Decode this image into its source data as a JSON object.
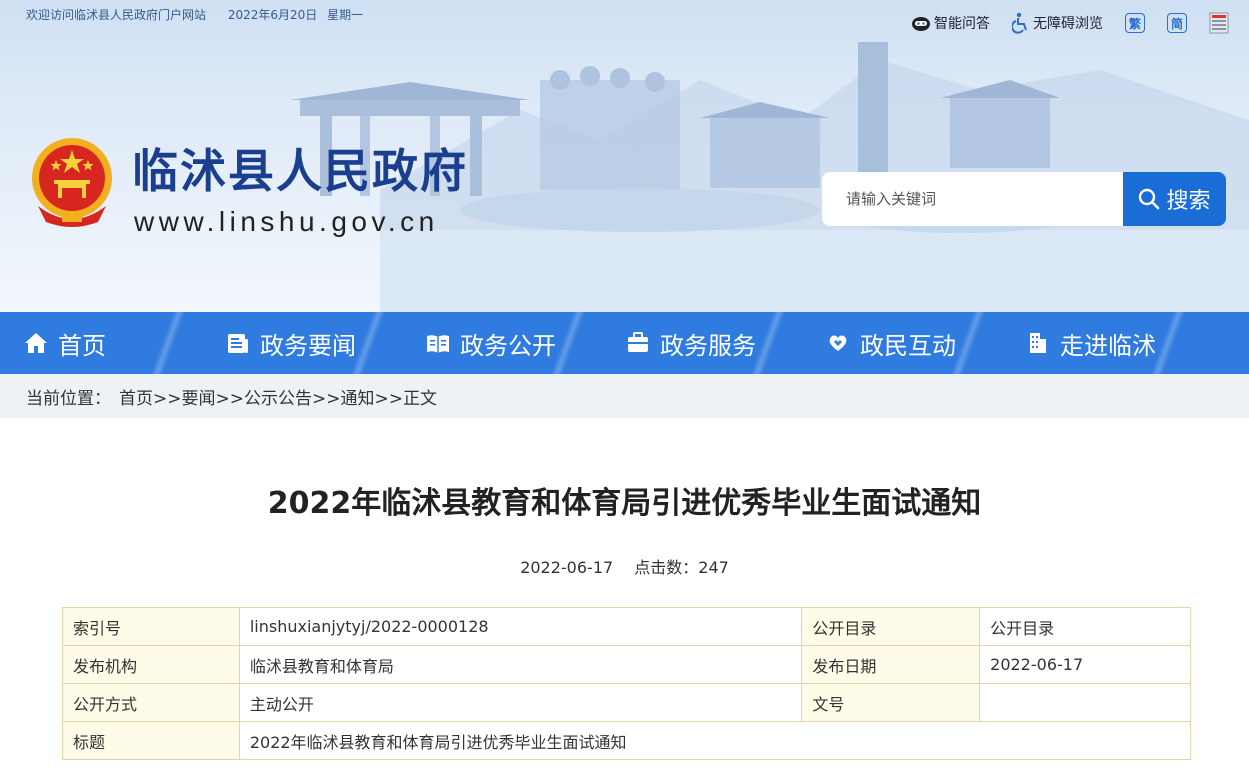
{
  "topbar": {
    "welcome": "欢迎访问临沭县人民政府门户网站",
    "date": "2022年6月20日",
    "weekday": "星期一",
    "tools": [
      {
        "label": "智能问答",
        "icon": "robot-icon"
      },
      {
        "label": "无障碍浏览",
        "icon": "accessibility-icon"
      }
    ],
    "traditional": "繁",
    "simplified": "简"
  },
  "header": {
    "site_name": "临沭县人民政府",
    "site_url": "www.linshu.gov.cn"
  },
  "search": {
    "placeholder": "请输入关键词",
    "button_label": "搜索"
  },
  "nav": {
    "items": [
      {
        "label": "首页",
        "icon": "home-icon"
      },
      {
        "label": "政务要闻",
        "icon": "news-icon"
      },
      {
        "label": "政务公开",
        "icon": "book-icon"
      },
      {
        "label": "政务服务",
        "icon": "service-icon"
      },
      {
        "label": "政民互动",
        "icon": "heart-hands-icon"
      },
      {
        "label": "走进临沭",
        "icon": "building-icon"
      }
    ]
  },
  "breadcrumb": {
    "label": "当前位置：",
    "path": "首页>>要闻>>公示公告>>通知>>正文"
  },
  "article": {
    "title": "2022年临沭县教育和体育局引进优秀毕业生面试通知",
    "date": "2022-06-17",
    "clicks": "点击数：247"
  },
  "info_table": {
    "rows": [
      {
        "k1": "索引号",
        "v1": "linshuxianjytyj/2022-0000128",
        "k2": "公开目录",
        "v2": "公开目录"
      },
      {
        "k1": "发布机构",
        "v1": "临沭县教育和体育局",
        "k2": "发布日期",
        "v2": "2022-06-17"
      },
      {
        "k1": "公开方式",
        "v1": "主动公开",
        "k2": "文号",
        "v2": ""
      },
      {
        "k1": "标题",
        "v1": "2022年临沭县教育和体育局引进优秀毕业生面试通知"
      }
    ]
  },
  "colors": {
    "nav": "#2f7be0",
    "search_button": "#1a6cd6",
    "site_name": "#1b3f8f"
  }
}
